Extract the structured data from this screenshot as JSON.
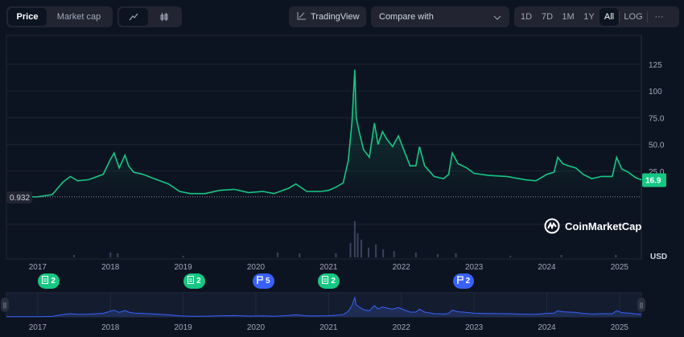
{
  "toolbar": {
    "price": "Price",
    "market_cap": "Market cap",
    "line_icon": "line-chart-icon",
    "candle_icon": "candlestick-icon",
    "tradingview": "TradingView",
    "compare": "Compare with",
    "ranges": [
      "1D",
      "7D",
      "1M",
      "1Y",
      "All"
    ],
    "active_range": "All",
    "log": "LOG",
    "more": "···"
  },
  "chart_data": {
    "type": "line",
    "title": "",
    "xlabel": "",
    "ylabel": "USD",
    "ylim": [
      0,
      135
    ],
    "yticks": [
      "25.0",
      "50.0",
      "75.0",
      "100",
      "125"
    ],
    "ytick_values": [
      25,
      50,
      75,
      100,
      125
    ],
    "xticks": [
      "2017",
      "2018",
      "2019",
      "2020",
      "2021",
      "2022",
      "2023",
      "2024",
      "2025"
    ],
    "xlim": [
      2016.57,
      2025.3
    ],
    "series": [
      {
        "name": "Price",
        "color": "#16c784",
        "x": [
          2016.57,
          2017.0,
          2017.2,
          2017.35,
          2017.45,
          2017.55,
          2017.7,
          2017.9,
          2018.0,
          2018.05,
          2018.12,
          2018.2,
          2018.25,
          2018.32,
          2018.45,
          2018.6,
          2018.8,
          2018.95,
          2019.1,
          2019.3,
          2019.5,
          2019.7,
          2019.9,
          2020.1,
          2020.25,
          2020.45,
          2020.55,
          2020.7,
          2020.9,
          2021.0,
          2021.1,
          2021.2,
          2021.27,
          2021.32,
          2021.36,
          2021.38,
          2021.42,
          2021.48,
          2021.56,
          2021.63,
          2021.68,
          2021.74,
          2021.8,
          2021.88,
          2021.96,
          2022.05,
          2022.12,
          2022.2,
          2022.25,
          2022.32,
          2022.45,
          2022.58,
          2022.65,
          2022.7,
          2022.78,
          2022.9,
          2023.0,
          2023.2,
          2023.45,
          2023.7,
          2023.85,
          2024.0,
          2024.1,
          2024.15,
          2024.22,
          2024.3,
          2024.4,
          2024.5,
          2024.62,
          2024.75,
          2024.9,
          2024.96,
          2025.03,
          2025.12,
          2025.22,
          2025.3
        ],
        "values": [
          0.9,
          1.0,
          3,
          15,
          20,
          16,
          17,
          22,
          36,
          42,
          28,
          40,
          30,
          24,
          22,
          18,
          13,
          6,
          4,
          4,
          7,
          8,
          5,
          6,
          4,
          9,
          13,
          6,
          6,
          7,
          10,
          14,
          35,
          70,
          120,
          75,
          62,
          45,
          38,
          70,
          50,
          62,
          55,
          48,
          58,
          42,
          30,
          30,
          48,
          30,
          20,
          18,
          22,
          42,
          32,
          28,
          23,
          21,
          20,
          17,
          16,
          22,
          24,
          38,
          32,
          30,
          28,
          22,
          18,
          20,
          20,
          38,
          27,
          24,
          19,
          16.9
        ]
      }
    ],
    "current_label": "16.9",
    "start_label": "0.932",
    "start_value": 0.932,
    "volume_x": [
      2017.5,
      2018.0,
      2018.1,
      2019.0,
      2020.3,
      2020.6,
      2021.1,
      2021.3,
      2021.36,
      2021.4,
      2021.45,
      2021.55,
      2021.65,
      2021.75,
      2021.9,
      2022.2,
      2022.5,
      2022.75,
      2023.5,
      2024.2,
      2024.95
    ],
    "volume_values": [
      3,
      6,
      5,
      2,
      6,
      5,
      5,
      18,
      45,
      30,
      22,
      12,
      16,
      10,
      8,
      6,
      4,
      5,
      2,
      3,
      3
    ]
  },
  "events": [
    {
      "type": "doc",
      "count": "2",
      "icon": "document-icon"
    },
    {
      "type": "doc",
      "count": "2",
      "icon": "document-icon"
    },
    {
      "type": "flag",
      "count": "5",
      "icon": "flag-icon"
    },
    {
      "type": "doc",
      "count": "2",
      "icon": "document-icon"
    },
    {
      "type": "flag",
      "count": "2",
      "icon": "flag-icon"
    }
  ],
  "event_years": [
    2017.15,
    2019.15,
    2020.1,
    2021.0,
    2022.85
  ],
  "watermark": "CoinMarketCap"
}
